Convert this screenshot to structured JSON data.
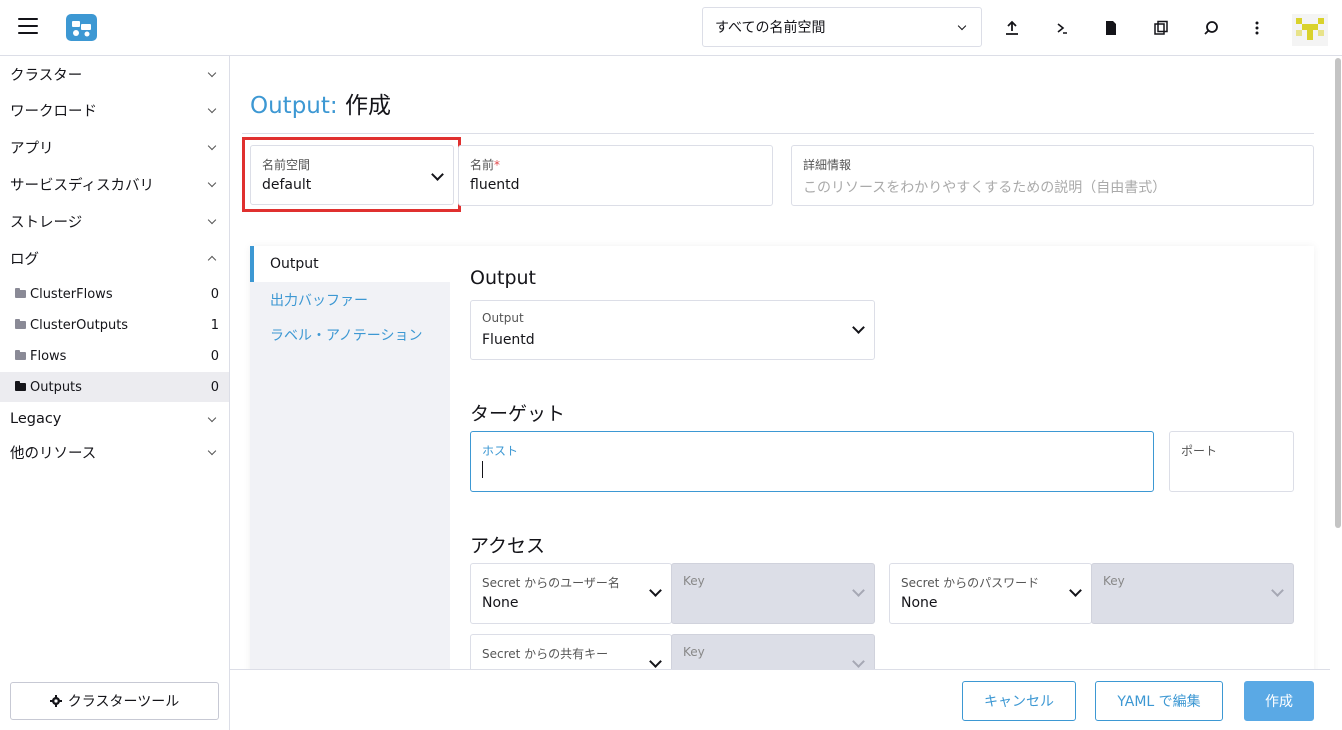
{
  "header": {
    "namespace_select": "すべての名前空間"
  },
  "sidebar": {
    "groups": [
      {
        "label": "クラスター"
      },
      {
        "label": "ワークロード"
      },
      {
        "label": "アプリ"
      },
      {
        "label": "サービスディスカバリ"
      },
      {
        "label": "ストレージ"
      },
      {
        "label": "ログ"
      }
    ],
    "log_items": [
      {
        "label": "ClusterFlows",
        "count": "0"
      },
      {
        "label": "ClusterOutputs",
        "count": "1"
      },
      {
        "label": "Flows",
        "count": "0"
      },
      {
        "label": "Outputs",
        "count": "0"
      }
    ],
    "legacy": "Legacy",
    "other_resources": "他のリソース",
    "cluster_tools": "クラスターツール"
  },
  "page": {
    "resource": "Output:",
    "action": "作成"
  },
  "form": {
    "namespace_label": "名前空間",
    "namespace_value": "default",
    "name_label": "名前",
    "name_required": "*",
    "name_value": "fluentd",
    "description_label": "詳細情報",
    "description_placeholder": "このリソースをわかりやすくするための説明（自由書式）"
  },
  "tabs": [
    {
      "label": "Output"
    },
    {
      "label": "出力バッファー"
    },
    {
      "label": "ラベル・アノテーション"
    }
  ],
  "output_section": {
    "heading": "Output",
    "select_label": "Output",
    "select_value": "Fluentd"
  },
  "target_section": {
    "heading": "ターゲット",
    "host_label": "ホスト",
    "port_label": "ポート"
  },
  "access_section": {
    "heading": "アクセス",
    "username_label": "Secret からのユーザー名",
    "username_value": "None",
    "username_key_label": "Key",
    "password_label": "Secret からのパスワード",
    "password_value": "None",
    "password_key_label": "Key",
    "shared_key_label": "Secret からの共有キー",
    "shared_key_key_label": "Key"
  },
  "footer": {
    "cancel": "キャンセル",
    "edit_yaml": "YAML で編集",
    "create": "作成"
  },
  "colors": {
    "accent": "#3d98d3",
    "highlight": "#e0302f"
  }
}
